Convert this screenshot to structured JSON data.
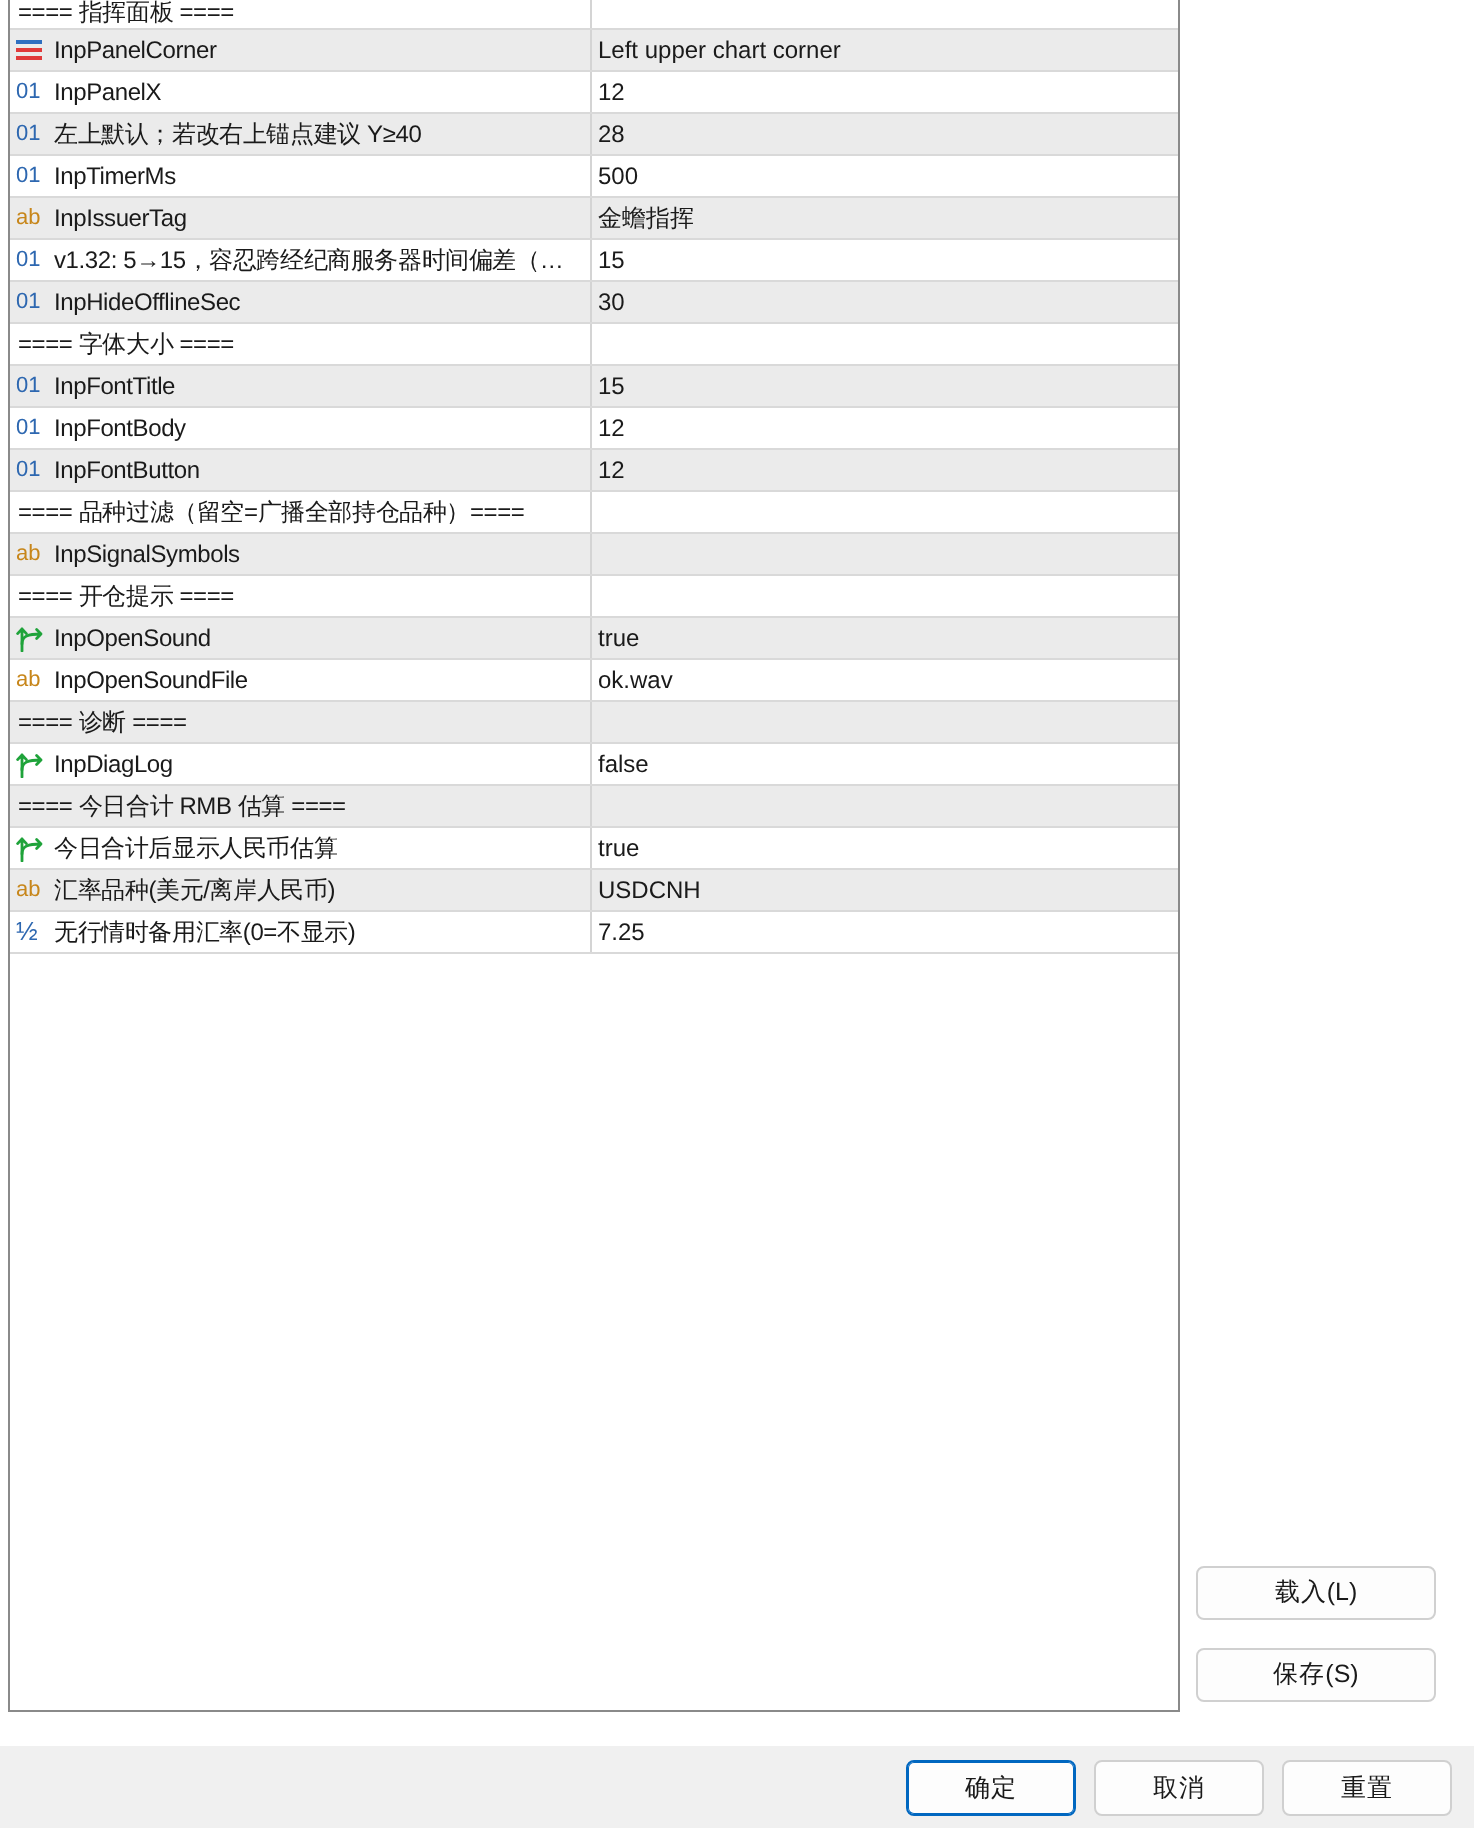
{
  "parameters": {
    "rows": [
      {
        "kind": "header",
        "name": "==== 指挥面板 ===="
      },
      {
        "kind": "enum",
        "name": "InpPanelCorner",
        "value": "Left upper chart corner"
      },
      {
        "kind": "int",
        "glyph": "01",
        "name": "InpPanelX",
        "value": "12"
      },
      {
        "kind": "int",
        "glyph": "01",
        "name": "左上默认；若改右上锚点建议 Y≥40",
        "value": "28"
      },
      {
        "kind": "int",
        "glyph": "01",
        "name": "InpTimerMs",
        "value": "500"
      },
      {
        "kind": "string",
        "glyph": "ab",
        "name": "InpIssuerTag",
        "value": "金蟾指挥"
      },
      {
        "kind": "int",
        "glyph": "01",
        "name": "v1.32: 5→15，容忍跨经纪商服务器时间偏差（…",
        "value": "15"
      },
      {
        "kind": "int",
        "glyph": "01",
        "name": "InpHideOfflineSec",
        "value": "30"
      },
      {
        "kind": "header",
        "name": "==== 字体大小 ===="
      },
      {
        "kind": "int",
        "glyph": "01",
        "name": "InpFontTitle",
        "value": "15"
      },
      {
        "kind": "int",
        "glyph": "01",
        "name": "InpFontBody",
        "value": "12"
      },
      {
        "kind": "int",
        "glyph": "01",
        "name": "InpFontButton",
        "value": "12"
      },
      {
        "kind": "header",
        "name": "==== 品种过滤（留空=广播全部持仓品种）===="
      },
      {
        "kind": "string",
        "glyph": "ab",
        "name": "InpSignalSymbols"
      },
      {
        "kind": "header",
        "name": "==== 开仓提示 ===="
      },
      {
        "kind": "bool",
        "name": "InpOpenSound",
        "value": "true"
      },
      {
        "kind": "string",
        "glyph": "ab",
        "name": "InpOpenSoundFile",
        "value": "ok.wav"
      },
      {
        "kind": "header",
        "name": "==== 诊断 ===="
      },
      {
        "kind": "bool",
        "name": "InpDiagLog",
        "value": "false"
      },
      {
        "kind": "header",
        "name": "==== 今日合计 RMB 估算 ===="
      },
      {
        "kind": "bool",
        "name": "今日合计后显示人民币估算",
        "value": "true"
      },
      {
        "kind": "string",
        "glyph": "ab",
        "name": "汇率品种(美元/离岸人民币)",
        "value": "USDCNH"
      },
      {
        "kind": "double",
        "glyph": "½",
        "name": "无行情时备用汇率(0=不显示)",
        "value": "7.25"
      }
    ]
  },
  "side_buttons": [
    {
      "label": "载入(L)"
    },
    {
      "label": "保存(S)"
    }
  ],
  "dialog_buttons": [
    {
      "label": "确定",
      "default": true
    },
    {
      "label": "取消",
      "default": false
    },
    {
      "label": "重置",
      "default": false
    }
  ]
}
